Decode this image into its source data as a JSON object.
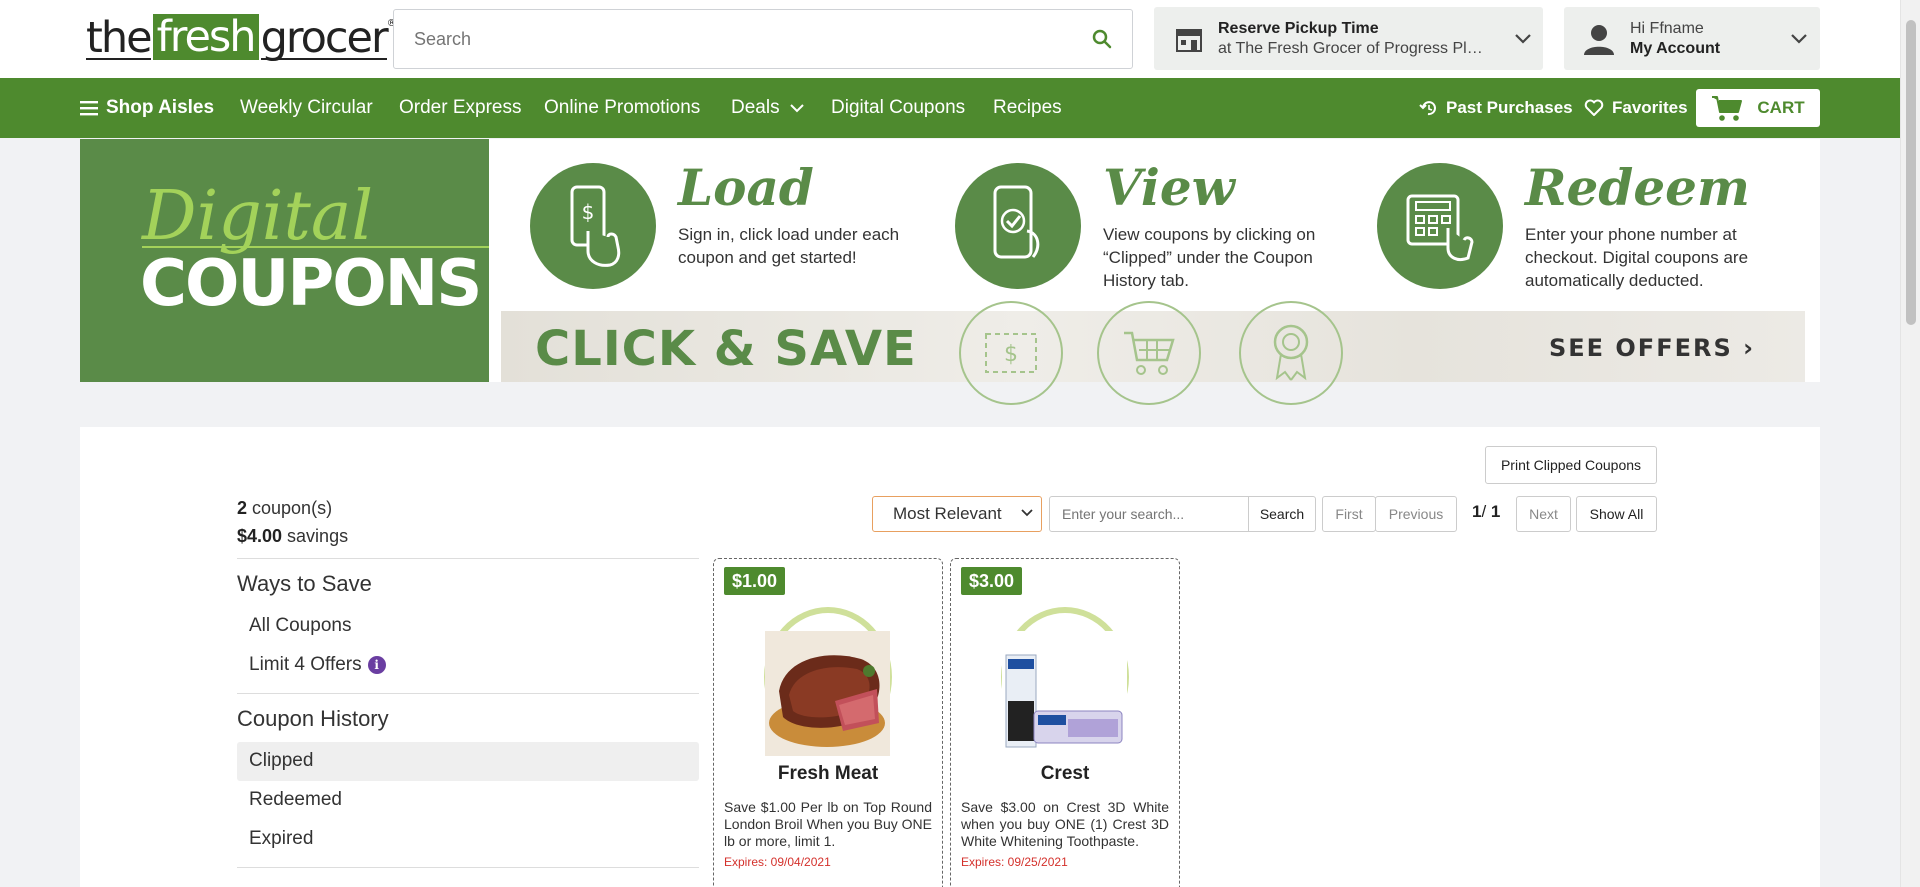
{
  "header": {
    "logo": {
      "pre": "the",
      "fresh": "fresh",
      "post": "grocer",
      "mark": "®"
    },
    "search_placeholder": "Search",
    "pickup": {
      "title": "Reserve Pickup Time",
      "store": "at The Fresh Grocer of Progress Plaza"
    },
    "account": {
      "greeting": "Hi Ffname",
      "label": "My Account"
    }
  },
  "nav": {
    "shop_aisles": "Shop Aisles",
    "weekly_circular": "Weekly Circular",
    "order_express": "Order Express",
    "online_promotions": "Online Promotions",
    "deals": "Deals",
    "digital_coupons": "Digital Coupons",
    "recipes": "Recipes",
    "past_purchases": "Past Purchases",
    "favorites": "Favorites",
    "cart": "CART"
  },
  "banner": {
    "digital": "Digital",
    "coupons": "COUPONS",
    "steps": [
      {
        "title": "Load",
        "desc": "Sign in, click load under each coupon and get started!"
      },
      {
        "title": "View",
        "desc": "View coupons by clicking on “Clipped” under the Coupon History tab."
      },
      {
        "title": "Redeem",
        "desc": "Enter your phone number at checkout. Digital coupons are automatically deducted."
      }
    ],
    "click_save": "CLICK & SAVE",
    "see_offers": "SEE OFFERS ›"
  },
  "coupons_page": {
    "print_label": "Print Clipped Coupons",
    "count_num": "2",
    "count_label": " coupon(s)",
    "savings_num": "$4.00",
    "savings_label": " savings",
    "sort_selected": "Most Relevant",
    "search_placeholder": "Enter your search...",
    "search_btn": "Search",
    "first": "First",
    "previous": "Previous",
    "page_current": "1",
    "page_sep": "/ ",
    "page_total": "1",
    "next": "Next",
    "show_all": "Show All"
  },
  "sidebar": {
    "ways_title": "Ways to Save",
    "all_coupons": "All Coupons",
    "limit_offers": "Limit 4 Offers",
    "info_glyph": "i",
    "history_title": "Coupon History",
    "clipped": "Clipped",
    "redeemed": "Redeemed",
    "expired": "Expired"
  },
  "cards": [
    {
      "amount": "$1.00",
      "name": "Fresh Meat",
      "desc": "Save $1.00 Per lb on Top Round London Broil When you Buy ONE lb or more, limit 1.",
      "expires": "Expires: 09/04/2021"
    },
    {
      "amount": "$3.00",
      "name": "Crest",
      "desc": "Save $3.00 on Crest 3D White when you buy ONE (1) Crest 3D White Whitening Toothpaste.",
      "expires": "Expires: 09/25/2021"
    }
  ],
  "colors": {
    "brand_green": "#4e8a2e",
    "banner_green": "#5a8b48",
    "expires_red": "#d4312c"
  }
}
